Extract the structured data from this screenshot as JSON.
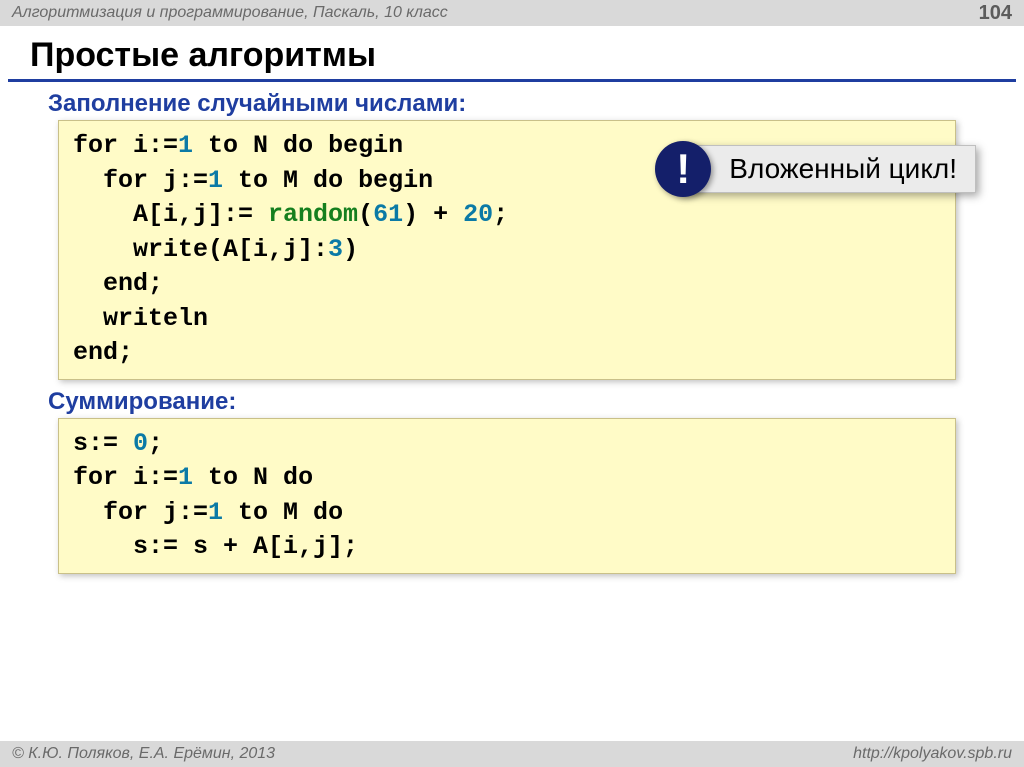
{
  "header": {
    "course": "Алгоритмизация и программирование, Паскаль, 10 класс",
    "page": "104"
  },
  "title": "Простые алгоритмы",
  "section1": "Заполнение случайными числами:",
  "section2": "Суммирование:",
  "callout": {
    "badge": "!",
    "text": "Вложенный цикл!"
  },
  "code1": {
    "l1a": "for i:=",
    "l1b": "1",
    "l1c": " to N do begin",
    "l2a": "  for j:=",
    "l2b": "1",
    "l2c": " to M do begin",
    "l3a": "    A[i,j]:= ",
    "l3fn": "random",
    "l3p1": "(",
    "l3n1": "61",
    "l3p2": ") + ",
    "l3n2": "20",
    "l3p3": ";",
    "l4a": "    write(A[i,j]:",
    "l4n": "3",
    "l4b": ")",
    "l5": "  end;",
    "l6": "  writeln",
    "l7": "end;"
  },
  "code2": {
    "l1a": "s:= ",
    "l1n": "0",
    "l1b": ";",
    "l2a": "for i:=",
    "l2n": "1",
    "l2b": " to N do",
    "l3a": "  for j:=",
    "l3n": "1",
    "l3b": " to M do",
    "l4": "    s:= s + A[i,j];"
  },
  "footer": {
    "authors": "© К.Ю. Поляков, Е.А. Ерёмин, 2013",
    "url": "http://kpolyakov.spb.ru"
  }
}
